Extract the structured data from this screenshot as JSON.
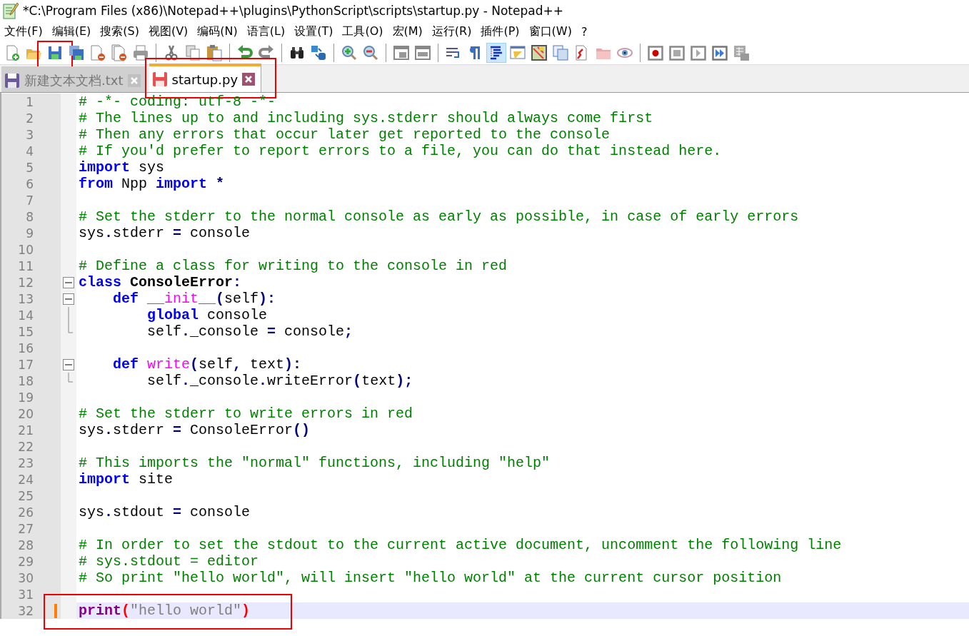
{
  "window": {
    "title": "*C:\\Program Files (x86)\\Notepad++\\plugins\\PythonScript\\scripts\\startup.py - Notepad++"
  },
  "menu": [
    "文件(F)",
    "编辑(E)",
    "搜索(S)",
    "视图(V)",
    "编码(N)",
    "语言(L)",
    "设置(T)",
    "工具(O)",
    "宏(M)",
    "运行(R)",
    "插件(P)",
    "窗口(W)",
    "?"
  ],
  "toolbar": [
    [
      {
        "pressed": false,
        "outlined": false
      },
      {
        "pressed": false,
        "outlined": false
      },
      {
        "pressed": false,
        "outlined": true
      },
      {
        "pressed": false,
        "outlined": false
      },
      {
        "pressed": false,
        "outlined": false
      },
      {
        "pressed": false,
        "outlined": false
      },
      {
        "pressed": false,
        "outlined": false
      }
    ],
    [
      {
        "pressed": false,
        "outlined": false
      },
      {
        "pressed": false,
        "outlined": false
      },
      {
        "pressed": false,
        "outlined": false
      }
    ],
    [
      {
        "pressed": false,
        "outlined": false
      },
      {
        "pressed": false,
        "outlined": false
      }
    ],
    [
      {
        "pressed": false,
        "outlined": false
      },
      {
        "pressed": false,
        "outlined": false
      }
    ],
    [
      {
        "pressed": false,
        "outlined": false
      },
      {
        "pressed": false,
        "outlined": false
      }
    ],
    [
      {
        "pressed": false,
        "outlined": false
      },
      {
        "pressed": false,
        "outlined": false
      }
    ],
    [
      {
        "pressed": false,
        "outlined": false
      },
      {
        "pressed": false,
        "outlined": false
      },
      {
        "pressed": true,
        "outlined": false
      },
      {
        "pressed": false,
        "outlined": false
      },
      {
        "pressed": false,
        "outlined": false
      },
      {
        "pressed": false,
        "outlined": false
      },
      {
        "pressed": false,
        "outlined": false
      },
      {
        "pressed": false,
        "outlined": false
      },
      {
        "pressed": false,
        "outlined": false
      }
    ],
    [
      {
        "pressed": false,
        "outlined": false
      },
      {
        "pressed": false,
        "outlined": false
      },
      {
        "pressed": false,
        "outlined": false
      },
      {
        "pressed": false,
        "outlined": false
      },
      {
        "pressed": false,
        "outlined": false
      }
    ]
  ],
  "tabs": [
    {
      "label": "新建文本文档.txt",
      "selected": false,
      "modified": false,
      "outlined": false
    },
    {
      "label": "startup.py",
      "selected": true,
      "modified": true,
      "outlined": true
    }
  ],
  "editor": {
    "lines": [
      {
        "number": "1",
        "current": false,
        "changed": false,
        "outlined": false,
        "tokens": [
          {
            "kind": "comment",
            "text": "# -*- coding: utf-8 -*-"
          }
        ]
      },
      {
        "number": "2",
        "current": false,
        "changed": false,
        "outlined": false,
        "tokens": [
          {
            "kind": "comment",
            "text": "# The lines up to and including sys.stderr should always come first"
          }
        ]
      },
      {
        "number": "3",
        "current": false,
        "changed": false,
        "outlined": false,
        "tokens": [
          {
            "kind": "comment",
            "text": "# Then any errors that occur later get reported to the console"
          }
        ]
      },
      {
        "number": "4",
        "current": false,
        "changed": false,
        "outlined": false,
        "tokens": [
          {
            "kind": "comment",
            "text": "# If you'd prefer to report errors to a file, you can do that instead here."
          }
        ]
      },
      {
        "number": "5",
        "current": false,
        "changed": false,
        "outlined": false,
        "tokens": [
          {
            "kind": "keyword",
            "text": "import"
          },
          {
            "kind": "plain",
            "text": " sys"
          }
        ]
      },
      {
        "number": "6",
        "current": false,
        "changed": false,
        "outlined": false,
        "tokens": [
          {
            "kind": "keyword",
            "text": "from"
          },
          {
            "kind": "plain",
            "text": " Npp "
          },
          {
            "kind": "keyword",
            "text": "import "
          },
          {
            "kind": "operator",
            "text": "*"
          }
        ]
      },
      {
        "number": "7",
        "current": false,
        "changed": false,
        "outlined": false
      },
      {
        "number": "8",
        "current": false,
        "changed": false,
        "outlined": false,
        "tokens": [
          {
            "kind": "comment",
            "text": "# Set the stderr to the normal console as early as possible, in case of early errors"
          }
        ]
      },
      {
        "number": "9",
        "current": false,
        "changed": false,
        "outlined": false,
        "tokens": [
          {
            "kind": "plain",
            "text": "sys"
          },
          {
            "kind": "operator",
            "text": "."
          },
          {
            "kind": "plain",
            "text": "stderr "
          },
          {
            "kind": "operator",
            "text": "="
          },
          {
            "kind": "plain",
            "text": " console"
          }
        ]
      },
      {
        "number": "10",
        "current": false,
        "changed": false,
        "outlined": false
      },
      {
        "number": "11",
        "current": false,
        "changed": false,
        "outlined": false,
        "tokens": [
          {
            "kind": "comment",
            "text": "# Define a class for writing to the console in red"
          }
        ]
      },
      {
        "number": "12",
        "kind": "fold-start",
        "current": false,
        "changed": false,
        "outlined": false,
        "tokens": [
          {
            "kind": "keyword",
            "text": "class "
          },
          {
            "kind": "classname",
            "text": "ConsoleError"
          },
          {
            "kind": "operator",
            "text": ":"
          }
        ]
      },
      {
        "number": "13",
        "kind": "fold-start",
        "current": false,
        "changed": false,
        "outlined": false,
        "tokens": [
          {
            "kind": "keyword",
            "text": "    def "
          },
          {
            "kind": "function",
            "text": "__init__"
          },
          {
            "kind": "operator",
            "text": "("
          },
          {
            "kind": "plain",
            "text": "self"
          },
          {
            "kind": "operator",
            "text": "):"
          }
        ]
      },
      {
        "number": "14",
        "kind": "fold-body",
        "current": false,
        "changed": false,
        "outlined": false,
        "tokens": [
          {
            "kind": "keyword",
            "text": "        global"
          },
          {
            "kind": "plain",
            "text": " console"
          }
        ]
      },
      {
        "number": "15",
        "kind": "fold-end",
        "current": false,
        "changed": false,
        "outlined": false,
        "tokens": [
          {
            "kind": "plain",
            "text": "        self"
          },
          {
            "kind": "operator",
            "text": "."
          },
          {
            "kind": "plain",
            "text": "_console "
          },
          {
            "kind": "operator",
            "text": "="
          },
          {
            "kind": "plain",
            "text": " console"
          },
          {
            "kind": "operator",
            "text": ";"
          }
        ]
      },
      {
        "number": "16",
        "current": false,
        "changed": false,
        "outlined": false
      },
      {
        "number": "17",
        "kind": "fold-start",
        "current": false,
        "changed": false,
        "outlined": false,
        "tokens": [
          {
            "kind": "keyword",
            "text": "    def "
          },
          {
            "kind": "function",
            "text": "write"
          },
          {
            "kind": "operator",
            "text": "("
          },
          {
            "kind": "plain",
            "text": "self"
          },
          {
            "kind": "operator",
            "text": ","
          },
          {
            "kind": "plain",
            "text": " text"
          },
          {
            "kind": "operator",
            "text": "):"
          }
        ]
      },
      {
        "number": "18",
        "kind": "fold-end",
        "current": false,
        "changed": false,
        "outlined": false,
        "tokens": [
          {
            "kind": "plain",
            "text": "        self"
          },
          {
            "kind": "operator",
            "text": "."
          },
          {
            "kind": "plain",
            "text": "_console"
          },
          {
            "kind": "operator",
            "text": "."
          },
          {
            "kind": "plain",
            "text": "writeError"
          },
          {
            "kind": "operator",
            "text": "("
          },
          {
            "kind": "plain",
            "text": "text"
          },
          {
            "kind": "operator",
            "text": ");"
          }
        ]
      },
      {
        "number": "19",
        "current": false,
        "changed": false,
        "outlined": false
      },
      {
        "number": "20",
        "current": false,
        "changed": false,
        "outlined": false,
        "tokens": [
          {
            "kind": "comment",
            "text": "# Set the stderr to write errors in red"
          }
        ]
      },
      {
        "number": "21",
        "current": false,
        "changed": false,
        "outlined": false,
        "tokens": [
          {
            "kind": "plain",
            "text": "sys"
          },
          {
            "kind": "operator",
            "text": "."
          },
          {
            "kind": "plain",
            "text": "stderr "
          },
          {
            "kind": "operator",
            "text": "="
          },
          {
            "kind": "plain",
            "text": " ConsoleError"
          },
          {
            "kind": "operator",
            "text": "()"
          }
        ]
      },
      {
        "number": "22",
        "current": false,
        "changed": false,
        "outlined": false
      },
      {
        "number": "23",
        "current": false,
        "changed": false,
        "outlined": false,
        "tokens": [
          {
            "kind": "comment",
            "text": "# This imports the \"normal\" functions, including \"help\""
          }
        ]
      },
      {
        "number": "24",
        "current": false,
        "changed": false,
        "outlined": false,
        "tokens": [
          {
            "kind": "keyword",
            "text": "import"
          },
          {
            "kind": "plain",
            "text": " site"
          }
        ]
      },
      {
        "number": "25",
        "current": false,
        "changed": false,
        "outlined": false
      },
      {
        "number": "26",
        "current": false,
        "changed": false,
        "outlined": false,
        "tokens": [
          {
            "kind": "plain",
            "text": "sys"
          },
          {
            "kind": "operator",
            "text": "."
          },
          {
            "kind": "plain",
            "text": "stdout "
          },
          {
            "kind": "operator",
            "text": "="
          },
          {
            "kind": "plain",
            "text": " console"
          }
        ]
      },
      {
        "number": "27",
        "current": false,
        "changed": false,
        "outlined": false
      },
      {
        "number": "28",
        "current": false,
        "changed": false,
        "outlined": false,
        "tokens": [
          {
            "kind": "comment",
            "text": "# In order to set the stdout to the current active document, uncomment the following line"
          }
        ]
      },
      {
        "number": "29",
        "current": false,
        "changed": false,
        "outlined": false,
        "tokens": [
          {
            "kind": "comment",
            "text": "# sys.stdout = editor"
          }
        ]
      },
      {
        "number": "30",
        "current": false,
        "changed": false,
        "outlined": false,
        "tokens": [
          {
            "kind": "comment",
            "text": "# So print \"hello world\", will insert \"hello world\" at the current cursor position"
          }
        ]
      },
      {
        "number": "31",
        "current": false,
        "changed": false,
        "outlined": false
      },
      {
        "number": "32",
        "current": true,
        "changed": true,
        "outlined": true,
        "tokens": [
          {
            "kind": "builtin",
            "text": "print"
          },
          {
            "kind": "brace",
            "text": "("
          },
          {
            "kind": "string",
            "text": "\"hello world\""
          },
          {
            "kind": "brace",
            "text": ")"
          }
        ]
      }
    ]
  }
}
